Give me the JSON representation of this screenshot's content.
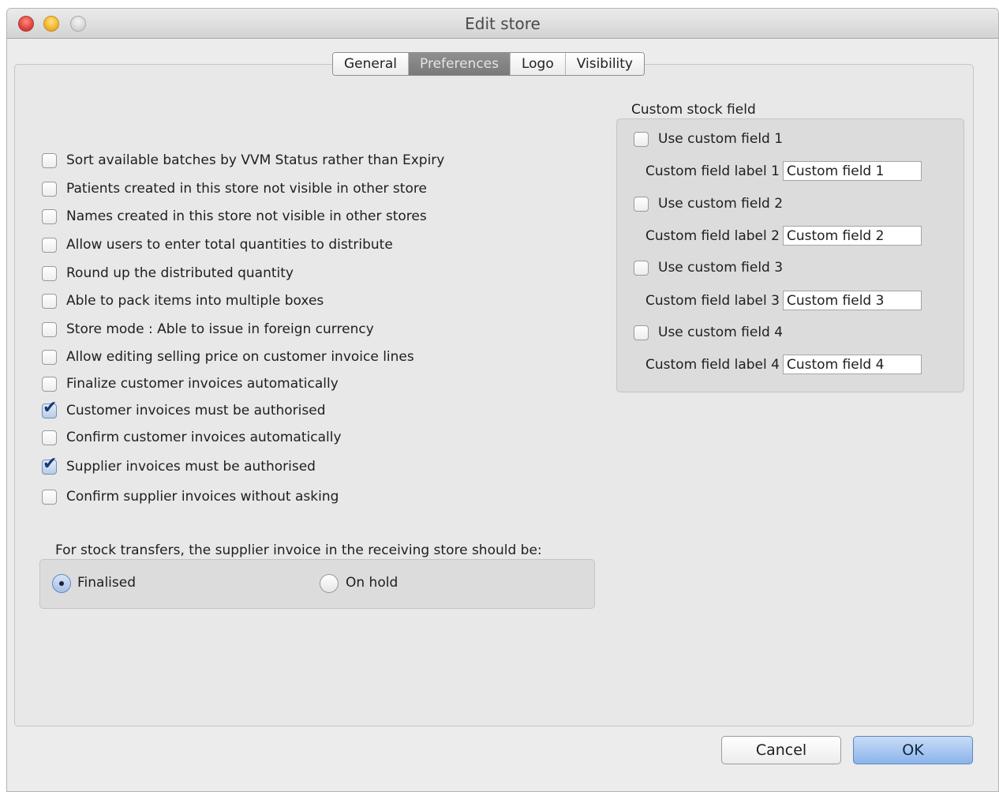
{
  "window": {
    "title": "Edit store"
  },
  "tabs": [
    {
      "label": "General",
      "active": false
    },
    {
      "label": "Preferences",
      "active": true
    },
    {
      "label": "Logo",
      "active": false
    },
    {
      "label": "Visibility",
      "active": false
    }
  ],
  "preferences": [
    {
      "label": "Sort available batches by VVM Status rather than Expiry",
      "checked": false
    },
    {
      "label": "Patients created in this store not visible in other store",
      "checked": false
    },
    {
      "label": "Names created in this store not visible in other stores",
      "checked": false
    },
    {
      "label": "Allow users to enter total quantities to distribute",
      "checked": false
    },
    {
      "label": "Round up the distributed quantity",
      "checked": false
    },
    {
      "label": "Able to pack items into multiple boxes",
      "checked": false
    },
    {
      "label": "Store mode : Able to issue in foreign currency",
      "checked": false
    },
    {
      "label": "Allow editing selling price on customer invoice lines",
      "checked": false
    },
    {
      "label": "Finalize customer invoices automatically",
      "checked": false
    },
    {
      "label": "Customer invoices must be authorised",
      "checked": true
    },
    {
      "label": "Confirm customer invoices automatically",
      "checked": false
    },
    {
      "label": "Supplier invoices must be authorised",
      "checked": true
    },
    {
      "label": "Confirm supplier invoices without asking",
      "checked": false
    }
  ],
  "stock_transfers": {
    "label": "For stock transfers, the supplier invoice in the receiving store should be:",
    "options": [
      {
        "label": "Finalised",
        "selected": true
      },
      {
        "label": "On hold",
        "selected": false
      }
    ]
  },
  "custom_stock_field": {
    "title": "Custom stock field",
    "fields": [
      {
        "use_label": "Use custom field 1",
        "checked": false,
        "field_label": "Custom field label 1",
        "value": "Custom field 1"
      },
      {
        "use_label": "Use custom field 2",
        "checked": false,
        "field_label": "Custom field label 2",
        "value": "Custom field 2"
      },
      {
        "use_label": "Use custom field 3",
        "checked": false,
        "field_label": "Custom field label 3",
        "value": "Custom field 3"
      },
      {
        "use_label": "Use custom field 4",
        "checked": false,
        "field_label": "Custom field label 4",
        "value": "Custom field 4"
      }
    ]
  },
  "buttons": {
    "cancel": "Cancel",
    "ok": "OK"
  }
}
